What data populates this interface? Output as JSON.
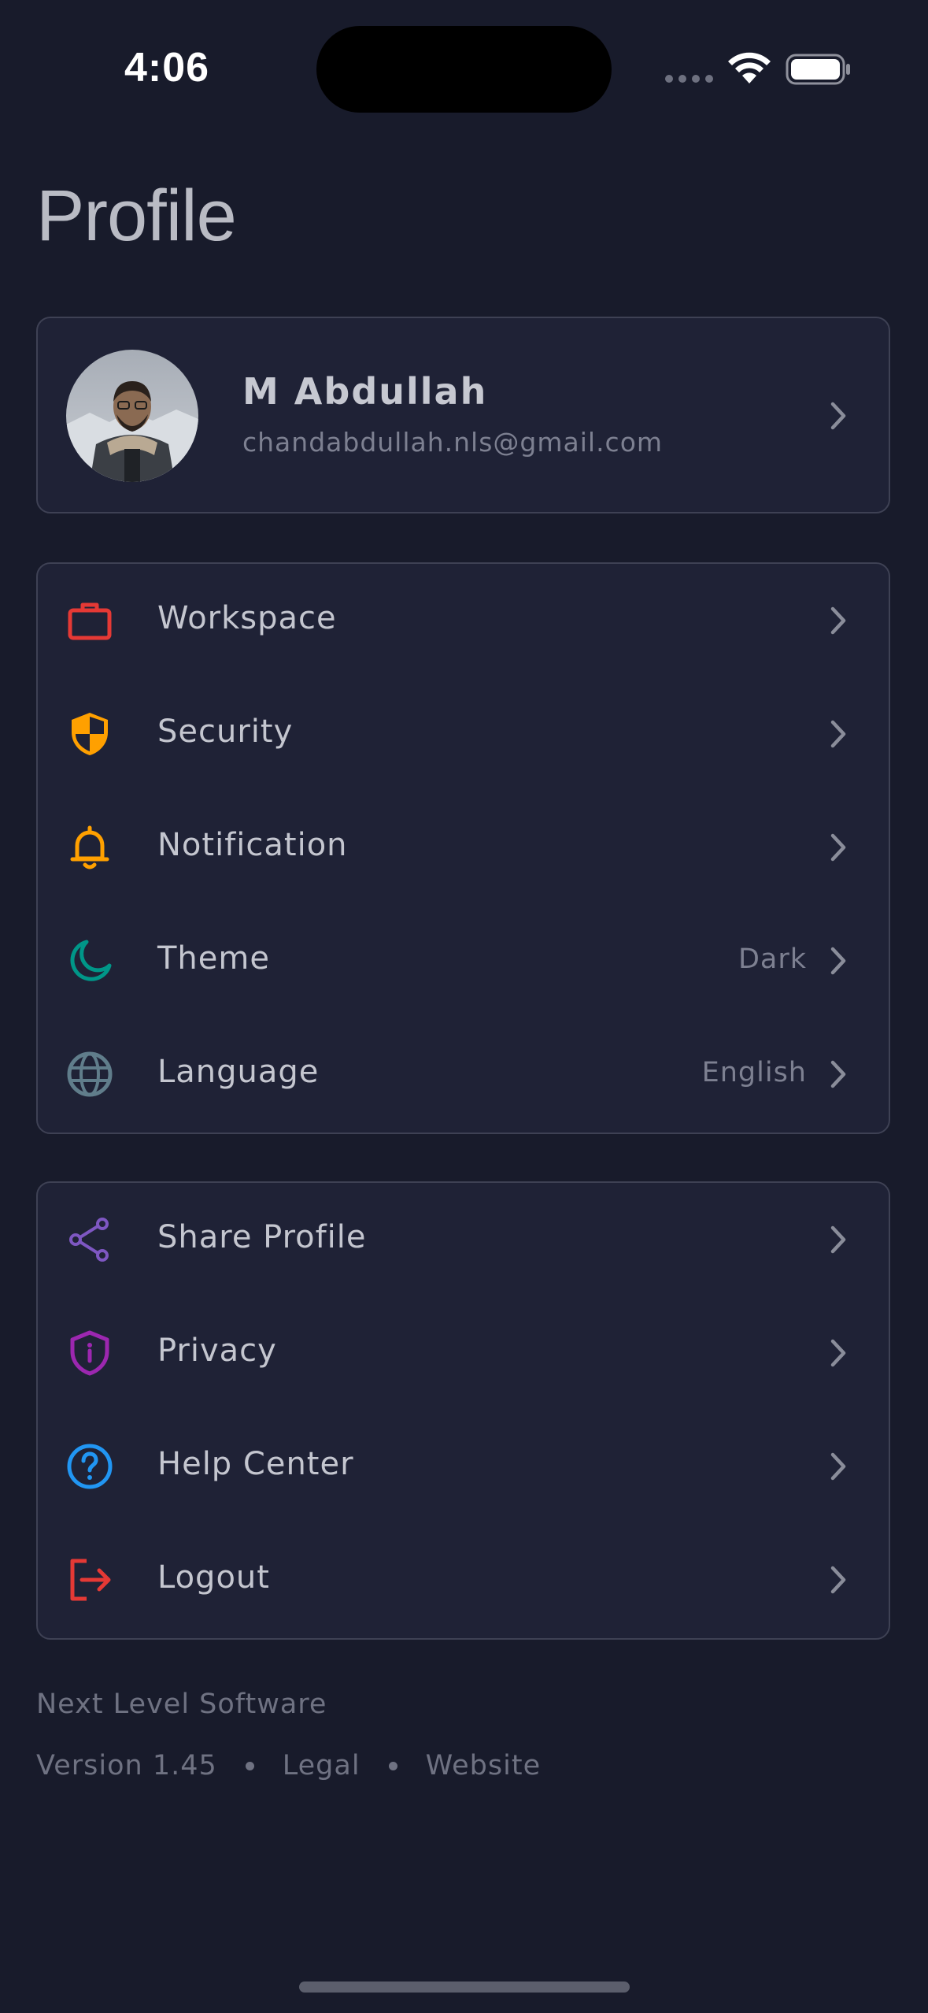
{
  "status_bar": {
    "time": "4:06"
  },
  "page": {
    "title": "Profile"
  },
  "profile": {
    "name": "M Abdullah",
    "email": "chandabdullah.nls@gmail.com"
  },
  "settings_group": [
    {
      "label": "Workspace",
      "value": "",
      "icon": "briefcase-icon",
      "color": "#e53935"
    },
    {
      "label": "Security",
      "value": "",
      "icon": "shield-icon",
      "color": "#ffa000"
    },
    {
      "label": "Notification",
      "value": "",
      "icon": "bell-icon",
      "color": "#ffa000"
    },
    {
      "label": "Theme",
      "value": "Dark",
      "icon": "moon-icon",
      "color": "#009688"
    },
    {
      "label": "Language",
      "value": "English",
      "icon": "globe-icon",
      "color": "#607d8b"
    }
  ],
  "account_group": [
    {
      "label": "Share Profile",
      "value": "",
      "icon": "share-icon",
      "color": "#7e57c2"
    },
    {
      "label": "Privacy",
      "value": "",
      "icon": "privacy-shield-icon",
      "color": "#9c27b0"
    },
    {
      "label": "Help Center",
      "value": "",
      "icon": "help-icon",
      "color": "#2196f3"
    },
    {
      "label": "Logout",
      "value": "",
      "icon": "logout-icon",
      "color": "#e53935"
    }
  ],
  "footer": {
    "company": "Next Level Software",
    "version": "Version 1.45",
    "legal": "Legal",
    "website": "Website"
  }
}
